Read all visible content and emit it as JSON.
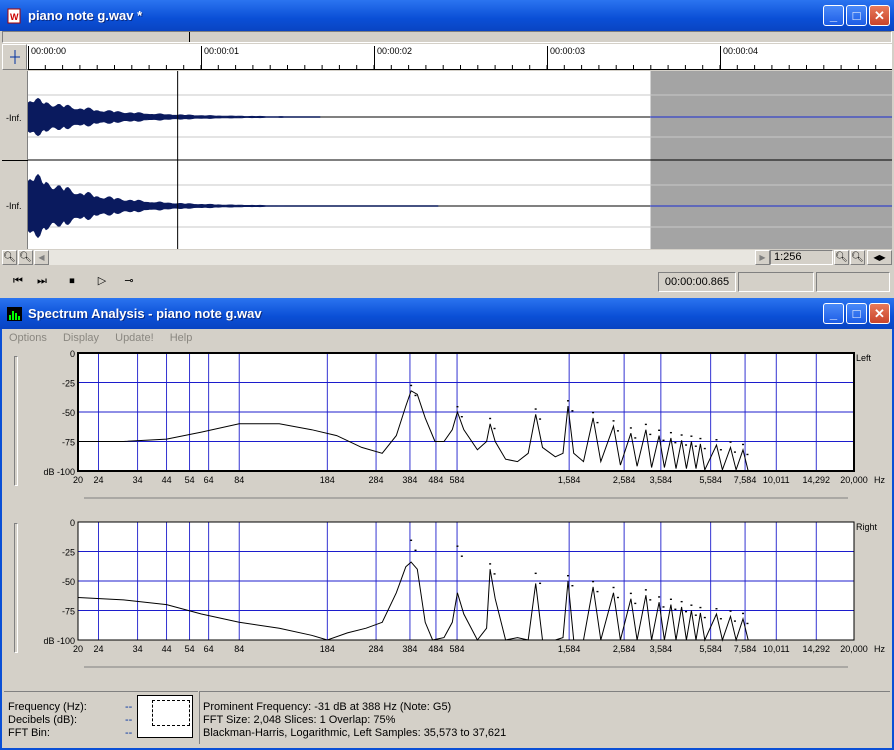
{
  "audio_window": {
    "title": "piano note g.wav *",
    "app_icon": "document-wav-icon",
    "ruler_ticks": [
      "00:00:00",
      "00:00:01",
      "00:00:02",
      "00:00:03",
      "00:00:04"
    ],
    "channel_labels": [
      "-Inf.",
      "-Inf."
    ],
    "zoom_ratio": "1:256",
    "position_time": "00:00:00.865",
    "cursor_position_s": 0.865,
    "selection_end_s": 3.5
  },
  "spectrum_window": {
    "title": "Spectrum Analysis - piano note g.wav",
    "menu": [
      "Options",
      "Display",
      "Update!",
      "Help"
    ],
    "channel_left": "Left",
    "channel_right": "Right",
    "y_ticks": [
      "0",
      "-25",
      "-50",
      "-75",
      "dB -100"
    ],
    "x_ticks": [
      "20",
      "24",
      "34",
      "44",
      "54",
      "64",
      "84",
      "184",
      "284",
      "384",
      "484",
      "584",
      "1,584",
      "2,584",
      "3,584",
      "5,584",
      "7,584",
      "10,011",
      "14,292",
      "20,000"
    ],
    "x_unit": "Hz",
    "info_labels": [
      "Frequency (Hz):",
      "Decibels (dB):",
      "FFT Bin:"
    ],
    "info_values": [
      "--",
      "--",
      "--"
    ],
    "status_lines": [
      "Prominent Frequency: -31 dB at 388 Hz (Note: G5)",
      "FFT Size: 2,048  Slices: 1  Overlap: 75%",
      "Blackman-Harris, Logarithmic, Left  Samples: 35,573 to 37,621"
    ]
  },
  "chart_data": [
    {
      "type": "line",
      "title": "Left",
      "xscale": "log",
      "xlim": [
        20,
        20000
      ],
      "ylim": [
        -100,
        0
      ],
      "ylabel": "dB",
      "grid": true,
      "peaks_hz": [
        388,
        586,
        784,
        1176,
        1568,
        1960,
        2352,
        2744,
        3136,
        3528,
        3920,
        4312,
        4704,
        5096,
        5880,
        6664,
        7448
      ],
      "peaks_db": [
        -32,
        -50,
        -60,
        -52,
        -45,
        -55,
        -62,
        -68,
        -65,
        -70,
        -72,
        -74,
        -75,
        -77,
        -78,
        -80,
        -82
      ],
      "x": [
        20,
        30,
        44,
        60,
        84,
        120,
        160,
        200,
        250,
        300,
        340,
        370,
        388,
        410,
        440,
        480,
        520,
        560,
        586,
        620,
        700,
        760,
        784,
        820,
        900,
        1000,
        1100,
        1176,
        1250,
        1400,
        1500,
        1568,
        1650,
        1800,
        1960,
        2100,
        2352,
        2500,
        2744,
        2900,
        3136,
        3300,
        3528,
        3700,
        3920,
        4100,
        4312,
        4500,
        4704,
        4900,
        5096,
        5300,
        5880,
        6200,
        6664,
        7000,
        7448,
        7800
      ],
      "y": [
        -75,
        -75,
        -73,
        -67,
        -60,
        -60,
        -65,
        -70,
        -80,
        -85,
        -70,
        -45,
        -32,
        -35,
        -55,
        -75,
        -75,
        -65,
        -50,
        -65,
        -82,
        -75,
        -60,
        -75,
        -90,
        -92,
        -85,
        -52,
        -80,
        -88,
        -85,
        -45,
        -85,
        -92,
        -55,
        -92,
        -62,
        -95,
        -68,
        -96,
        -65,
        -97,
        -70,
        -97,
        -72,
        -98,
        -74,
        -98,
        -75,
        -98,
        -77,
        -99,
        -78,
        -99,
        -80,
        -99,
        -82,
        -100
      ]
    },
    {
      "type": "line",
      "title": "Right",
      "xscale": "log",
      "xlim": [
        20,
        20000
      ],
      "ylim": [
        -100,
        0
      ],
      "ylabel": "dB",
      "grid": true,
      "peaks_hz": [
        388,
        586,
        784,
        1176,
        1568,
        1960,
        2352,
        2744,
        3136,
        3528,
        3920,
        4312,
        4704,
        5096,
        5880,
        6664,
        7448
      ],
      "peaks_db": [
        -20,
        -25,
        -40,
        -48,
        -50,
        -55,
        -60,
        -65,
        -62,
        -68,
        -70,
        -72,
        -75,
        -77,
        -78,
        -80,
        -82
      ],
      "x": [
        20,
        30,
        44,
        60,
        84,
        120,
        160,
        184,
        220,
        260,
        300,
        340,
        370,
        388,
        410,
        440,
        470,
        520,
        560,
        586,
        620,
        700,
        760,
        784,
        820,
        900,
        1000,
        1100,
        1176,
        1250,
        1400,
        1500,
        1568,
        1650,
        1800,
        1960,
        2100,
        2352,
        2500,
        2744,
        2900,
        3136,
        3300,
        3528,
        3700,
        3920,
        4100,
        4312,
        4500,
        4704,
        4900,
        5096,
        5300,
        5880,
        6200,
        6664,
        7000,
        7448,
        7800
      ],
      "y": [
        -64,
        -66,
        -70,
        -78,
        -85,
        -90,
        -96,
        -100,
        -94,
        -90,
        -85,
        -60,
        -38,
        -34,
        -40,
        -85,
        -100,
        -98,
        -85,
        -60,
        -78,
        -100,
        -90,
        -40,
        -65,
        -100,
        -98,
        -100,
        -52,
        -100,
        -100,
        -98,
        -50,
        -100,
        -100,
        -55,
        -100,
        -60,
        -100,
        -65,
        -100,
        -62,
        -100,
        -68,
        -100,
        -70,
        -100,
        -72,
        -100,
        -75,
        -100,
        -77,
        -100,
        -78,
        -100,
        -80,
        -100,
        -82,
        -100
      ]
    }
  ]
}
